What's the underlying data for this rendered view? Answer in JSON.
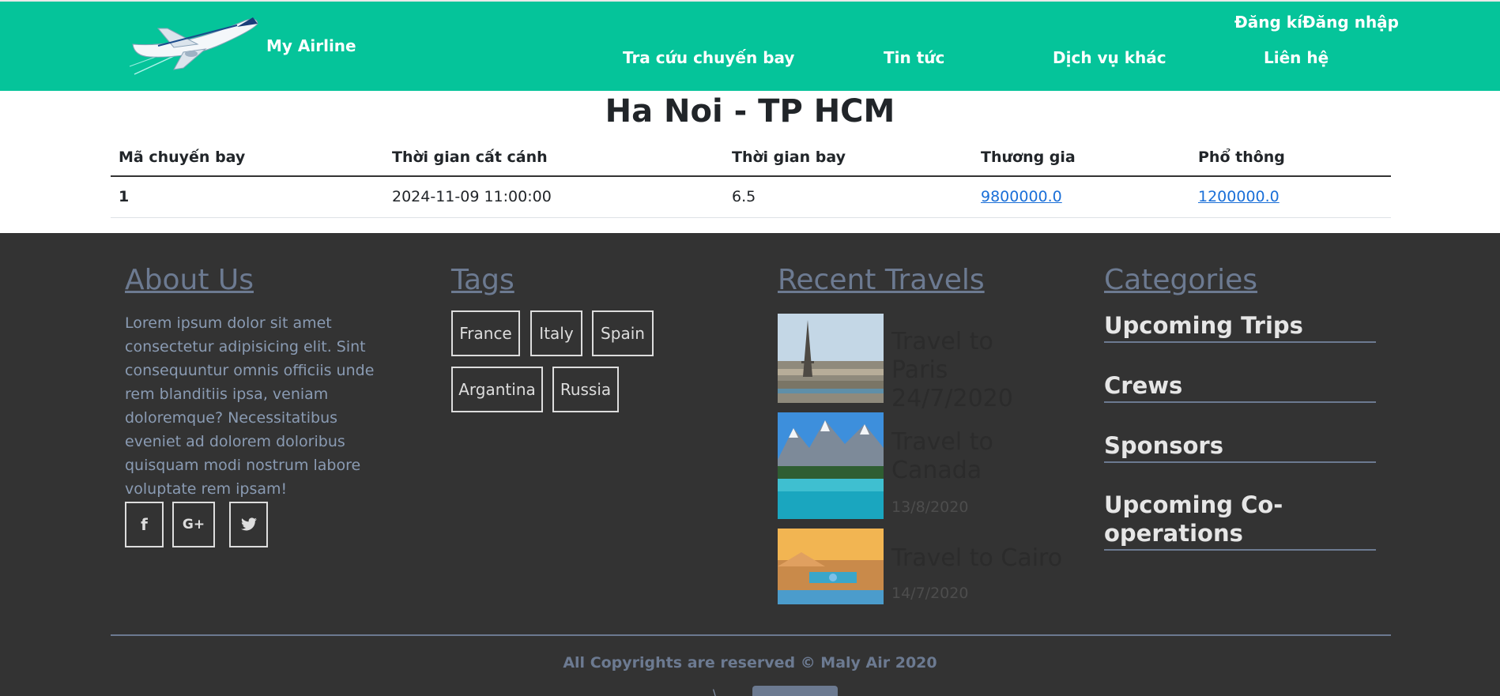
{
  "header": {
    "brand": "My Airline",
    "auth_links": "Đăng kíĐăng nhập",
    "nav": [
      {
        "label": "Tra cứu chuyến bay"
      },
      {
        "label": "Tin tức"
      },
      {
        "label": "Dịch vụ khác"
      },
      {
        "label": "Liên hệ"
      }
    ]
  },
  "route": {
    "title": "Ha Noi - TP HCM"
  },
  "table": {
    "headers": [
      "Mã chuyến bay",
      "Thời gian cất cánh",
      "Thời gian bay",
      "Thương gia",
      "Phổ thông"
    ],
    "rows": [
      {
        "id": "1",
        "departure": "2024-11-09 11:00:00",
        "duration": "6.5",
        "business": "9800000.0",
        "economy": "1200000.0"
      }
    ]
  },
  "footer": {
    "about": {
      "heading": "About Us",
      "text": "Lorem ipsum dolor sit amet consectetur adipisicing elit. Sint consequuntur omnis officiis unde rem blanditiis ipsa, veniam doloremque? Necessitatibus eveniet ad dolorem doloribus quisquam modi nostrum labore voluptate rem ipsam!",
      "social": [
        {
          "icon": "facebook-icon",
          "glyph": "f"
        },
        {
          "icon": "google-plus-icon",
          "glyph": "G+"
        },
        {
          "icon": "twitter-icon",
          "glyph": "🐦"
        }
      ]
    },
    "tags": {
      "heading": "Tags",
      "items": [
        "France",
        "Italy",
        "Spain",
        "Argantina",
        "Russia"
      ]
    },
    "recent": {
      "heading": "Recent Travels",
      "items": [
        {
          "title": "Travel to Paris 24/7/2020",
          "date": ""
        },
        {
          "title": "Travel to Canada",
          "date": "13/8/2020"
        },
        {
          "title": "Travel to Cairo",
          "date": "14/7/2020"
        }
      ]
    },
    "categories": {
      "heading": "Categories",
      "items": [
        "Upcoming Trips",
        "Crews",
        "Sponsors",
        "Upcoming Co-operations"
      ]
    },
    "copyright": "All Copyrights are reserved © Maly Air 2020",
    "stub_text": "\\"
  },
  "colors": {
    "header_bg": "#05c49a",
    "footer_bg": "#333333",
    "link": "#1a6fd8",
    "muted_heading": "#6c7a91"
  }
}
